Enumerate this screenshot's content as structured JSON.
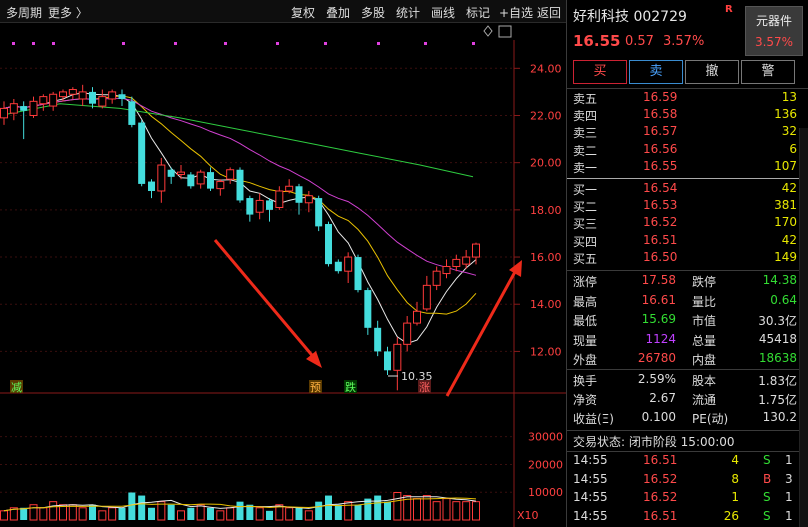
{
  "toolbar": {
    "period": "多周期",
    "more": "更多 〉",
    "buttons": [
      "复权",
      "叠加",
      "多股",
      "统计",
      "画线",
      "标记",
      "+自选",
      "返回"
    ]
  },
  "chart_data": {
    "type": "candlestick",
    "ylim": [
      11.0,
      25.2
    ],
    "yticks": [
      "24.00",
      "22.00",
      "20.00",
      "18.00",
      "16.00",
      "14.00",
      "12.00"
    ],
    "vol_ticks": [
      "30000",
      "20000",
      "10000"
    ],
    "vol_unit": "X10",
    "low_annotation": "10.35",
    "markers": [
      "减",
      "预",
      "跌",
      "涨"
    ],
    "candles": [
      [
        21.9,
        22.3,
        22.6,
        21.6
      ],
      [
        22.1,
        22.5,
        22.7,
        21.8
      ],
      [
        22.4,
        22.2,
        22.6,
        21.0
      ],
      [
        22.0,
        22.6,
        22.8,
        21.9
      ],
      [
        22.5,
        22.8,
        22.9,
        22.2
      ],
      [
        22.4,
        22.9,
        23.0,
        22.2
      ],
      [
        22.8,
        23.0,
        23.1,
        22.6
      ],
      [
        22.9,
        23.1,
        23.2,
        22.7
      ],
      [
        22.7,
        23.0,
        23.3,
        22.4
      ],
      [
        23.0,
        22.5,
        23.2,
        22.3
      ],
      [
        22.4,
        22.8,
        23.1,
        22.3
      ],
      [
        22.7,
        23.0,
        23.1,
        22.5
      ],
      [
        22.9,
        22.7,
        23.1,
        22.4
      ],
      [
        22.6,
        21.6,
        22.8,
        21.5
      ],
      [
        21.7,
        19.1,
        21.8,
        19.0
      ],
      [
        19.2,
        18.8,
        19.3,
        18.5
      ],
      [
        18.8,
        19.9,
        20.2,
        18.3
      ],
      [
        19.7,
        19.4,
        19.8,
        19.1
      ],
      [
        19.5,
        19.6,
        19.9,
        19.3
      ],
      [
        19.5,
        19.0,
        19.6,
        18.9
      ],
      [
        19.1,
        19.6,
        19.7,
        18.9
      ],
      [
        19.6,
        18.9,
        19.8,
        18.8
      ],
      [
        18.9,
        19.2,
        19.3,
        18.6
      ],
      [
        19.3,
        19.7,
        19.8,
        19.1
      ],
      [
        19.7,
        18.4,
        19.8,
        18.3
      ],
      [
        18.5,
        17.8,
        18.6,
        17.5
      ],
      [
        17.9,
        18.4,
        18.7,
        17.6
      ],
      [
        18.4,
        18.0,
        18.5,
        17.5
      ],
      [
        18.1,
        18.8,
        19.0,
        18.0
      ],
      [
        18.8,
        19.0,
        19.3,
        18.7
      ],
      [
        19.0,
        18.3,
        19.1,
        17.8
      ],
      [
        18.3,
        18.6,
        18.8,
        17.9
      ],
      [
        18.5,
        17.3,
        18.6,
        17.1
      ],
      [
        17.4,
        15.7,
        17.5,
        15.6
      ],
      [
        15.8,
        15.4,
        15.9,
        15.3
      ],
      [
        15.4,
        16.0,
        16.2,
        14.9
      ],
      [
        16.0,
        14.6,
        16.1,
        14.5
      ],
      [
        14.6,
        13.0,
        14.7,
        12.7
      ],
      [
        13.0,
        12.0,
        13.3,
        11.8
      ],
      [
        12.0,
        11.2,
        12.2,
        11.0
      ],
      [
        11.2,
        12.3,
        12.6,
        10.35
      ],
      [
        12.3,
        13.2,
        13.5,
        12.0
      ],
      [
        13.2,
        13.7,
        14.1,
        13.1
      ],
      [
        13.8,
        14.8,
        15.2,
        13.7
      ],
      [
        14.8,
        15.4,
        15.6,
        14.6
      ],
      [
        15.3,
        15.6,
        15.9,
        15.1
      ],
      [
        15.6,
        15.9,
        16.1,
        15.4
      ],
      [
        15.7,
        16.0,
        16.3,
        15.5
      ],
      [
        16.0,
        16.55,
        16.61,
        15.69
      ]
    ],
    "volumes": [
      3,
      4,
      4,
      5,
      4,
      6,
      5,
      5,
      4,
      5,
      3,
      4,
      4,
      9,
      8,
      4,
      6,
      5,
      3,
      4,
      5,
      4,
      3,
      4,
      6,
      5,
      4,
      3,
      5,
      4,
      4,
      3,
      6,
      8,
      5,
      6,
      5,
      7,
      8,
      6,
      9,
      8,
      7,
      8,
      6,
      7,
      6,
      6,
      6
    ]
  },
  "quote": {
    "name_code": "好利科技 002729",
    "badge_r": "R",
    "price": "16.55",
    "change": "0.57",
    "pct": "3.57%",
    "sector": "元器件",
    "sector_pct": "3.57%"
  },
  "trade_buttons": [
    "买",
    "卖",
    "撤",
    "警"
  ],
  "sells": [
    {
      "label": "卖五",
      "price": "16.59",
      "vol": "13"
    },
    {
      "label": "卖四",
      "price": "16.58",
      "vol": "136"
    },
    {
      "label": "卖三",
      "price": "16.57",
      "vol": "32"
    },
    {
      "label": "卖二",
      "price": "16.56",
      "vol": "6"
    },
    {
      "label": "卖一",
      "price": "16.55",
      "vol": "107"
    }
  ],
  "buys": [
    {
      "label": "买一",
      "price": "16.54",
      "vol": "42"
    },
    {
      "label": "买二",
      "price": "16.53",
      "vol": "381"
    },
    {
      "label": "买三",
      "price": "16.52",
      "vol": "170"
    },
    {
      "label": "买四",
      "price": "16.51",
      "vol": "42"
    },
    {
      "label": "买五",
      "price": "16.50",
      "vol": "149"
    }
  ],
  "stats": [
    {
      "l1": "涨停",
      "v1": "17.58",
      "c1": "#ff4a4a",
      "l2": "跌停",
      "v2": "14.38",
      "c2": "#33dd33"
    },
    {
      "l1": "最高",
      "v1": "16.61",
      "c1": "#ff4a4a",
      "l2": "量比",
      "v2": "0.64",
      "c2": "#33dd33"
    },
    {
      "l1": "最低",
      "v1": "15.69",
      "c1": "#33dd33",
      "l2": "市值",
      "v2": "30.3亿",
      "c2": "#dddddd"
    },
    {
      "l1": "现量",
      "v1": "1124",
      "c1": "#c040ff",
      "l2": "总量",
      "v2": "45418",
      "c2": "#dddddd"
    },
    {
      "l1": "外盘",
      "v1": "26780",
      "c1": "#ff4a4a",
      "l2": "内盘",
      "v2": "18638",
      "c2": "#33dd33"
    }
  ],
  "stats2": [
    {
      "l1": "换手",
      "v1": "2.59%",
      "l2": "股本",
      "v2": "1.83亿"
    },
    {
      "l1": "净资",
      "v1": "2.67",
      "l2": "流通",
      "v2": "1.75亿"
    },
    {
      "l1": "收益(Ξ)",
      "v1": "0.100",
      "l2": "PE(动)",
      "v2": "130.2"
    }
  ],
  "status": "交易状态: 闭市阶段 15:00:00",
  "ticks": [
    {
      "time": "14:55",
      "price": "16.51",
      "vol": "4",
      "side": "S",
      "dir": "1",
      "sc": "#33dd33"
    },
    {
      "time": "14:55",
      "price": "16.52",
      "vol": "8",
      "side": "B",
      "dir": "3",
      "sc": "#ff4a4a"
    },
    {
      "time": "14:55",
      "price": "16.52",
      "vol": "1",
      "side": "S",
      "dir": "1",
      "sc": "#33dd33"
    },
    {
      "time": "14:55",
      "price": "16.51",
      "vol": "26",
      "side": "S",
      "dir": "1",
      "sc": "#33dd33"
    }
  ]
}
